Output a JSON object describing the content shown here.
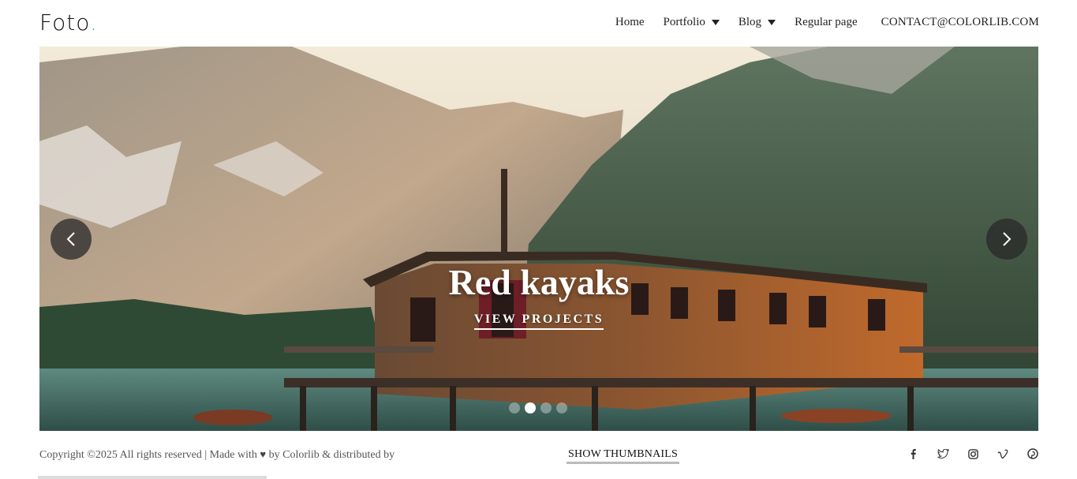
{
  "logo": {
    "text": "Foto",
    "dot": "."
  },
  "nav": {
    "home": "Home",
    "portfolio": "Portfolio",
    "blog": "Blog",
    "regular": "Regular page",
    "contact": "CONTACT@COLORLIB.COM"
  },
  "hero": {
    "title": "Red kayaks",
    "cta": "VIEW PROJECTS",
    "slide_count": 4,
    "active_slide": 2
  },
  "footer": {
    "copyright_left": "Copyright ©2025 All rights reserved | Made with",
    "copyright_right": "by Colorlib & distributed by",
    "show_thumbnails": "SHOW THUMBNAILS"
  },
  "social": [
    "facebook-icon",
    "twitter-icon",
    "instagram-icon",
    "vimeo-icon",
    "pinterest-icon"
  ],
  "colors": {
    "accent": "#20c46b",
    "text": "#222222"
  }
}
